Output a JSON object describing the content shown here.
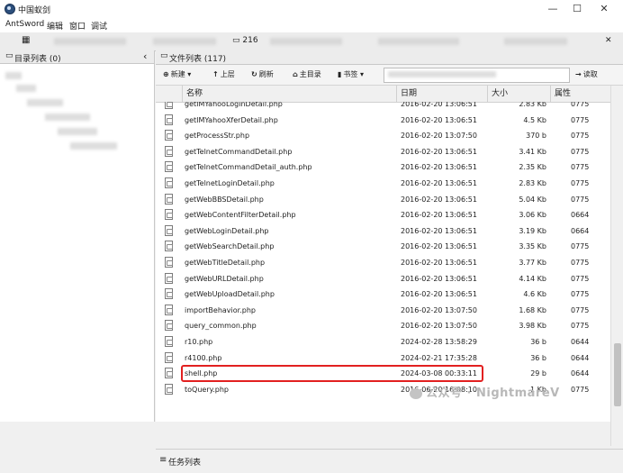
{
  "app": {
    "title": "中国蚁剑",
    "icon": "ant-logo-icon"
  },
  "window_controls": {
    "minimize": "—",
    "maximize": "☐",
    "close": "✕"
  },
  "menu": [
    "AntSword",
    "编辑",
    "窗口",
    "调试"
  ],
  "tabs": {
    "grid_icon": "▦",
    "file_tab_label": "216",
    "close_icon": "✕"
  },
  "left_panel": {
    "title": "目录列表 (0)",
    "collapse_icon": "‹"
  },
  "right_panel": {
    "title": "文件列表 (117)"
  },
  "toolbar": {
    "new_label": "新建",
    "up_label": "上层",
    "refresh_label": "刷新",
    "home_label": "主目录",
    "bookmark_label": "书签",
    "read_label": "读取",
    "path_value": ""
  },
  "columns": {
    "name": "名称",
    "date": "日期",
    "size": "大小",
    "perm": "属性"
  },
  "files": [
    {
      "name": "getIMYahooLoginDetail.php",
      "date": "2016-02-20 13:06:51",
      "size": "2.83 Kb",
      "perm": "0775"
    },
    {
      "name": "getIMYahooXferDetail.php",
      "date": "2016-02-20 13:06:51",
      "size": "4.5 Kb",
      "perm": "0775"
    },
    {
      "name": "getProcessStr.php",
      "date": "2016-02-20 13:07:50",
      "size": "370 b",
      "perm": "0775"
    },
    {
      "name": "getTelnetCommandDetail.php",
      "date": "2016-02-20 13:06:51",
      "size": "3.41 Kb",
      "perm": "0775"
    },
    {
      "name": "getTelnetCommandDetail_auth.php",
      "date": "2016-02-20 13:06:51",
      "size": "2.35 Kb",
      "perm": "0775"
    },
    {
      "name": "getTelnetLoginDetail.php",
      "date": "2016-02-20 13:06:51",
      "size": "2.83 Kb",
      "perm": "0775"
    },
    {
      "name": "getWebBBSDetail.php",
      "date": "2016-02-20 13:06:51",
      "size": "5.04 Kb",
      "perm": "0775"
    },
    {
      "name": "getWebContentFilterDetail.php",
      "date": "2016-02-20 13:06:51",
      "size": "3.06 Kb",
      "perm": "0664"
    },
    {
      "name": "getWebLoginDetail.php",
      "date": "2016-02-20 13:06:51",
      "size": "3.19 Kb",
      "perm": "0664"
    },
    {
      "name": "getWebSearchDetail.php",
      "date": "2016-02-20 13:06:51",
      "size": "3.35 Kb",
      "perm": "0775"
    },
    {
      "name": "getWebTitleDetail.php",
      "date": "2016-02-20 13:06:51",
      "size": "3.77 Kb",
      "perm": "0775"
    },
    {
      "name": "getWebURLDetail.php",
      "date": "2016-02-20 13:06:51",
      "size": "4.14 Kb",
      "perm": "0775"
    },
    {
      "name": "getWebUploadDetail.php",
      "date": "2016-02-20 13:06:51",
      "size": "4.6 Kb",
      "perm": "0775"
    },
    {
      "name": "importBehavior.php",
      "date": "2016-02-20 13:07:50",
      "size": "1.68 Kb",
      "perm": "0775"
    },
    {
      "name": "query_common.php",
      "date": "2016-02-20 13:07:50",
      "size": "3.98 Kb",
      "perm": "0775"
    },
    {
      "name": "r10.php",
      "date": "2024-02-28 13:58:29",
      "size": "36 b",
      "perm": "0644"
    },
    {
      "name": "r4100.php",
      "date": "2024-02-21 17:35:28",
      "size": "36 b",
      "perm": "0644"
    },
    {
      "name": "shell.php",
      "date": "2024-03-08 00:33:11",
      "size": "29 b",
      "perm": "0644"
    },
    {
      "name": "toQuery.php",
      "date": "2016-06-20 16:08:10",
      "size": "1 Kb",
      "perm": "0775"
    }
  ],
  "status_bar": {
    "label": "任务列表",
    "toggle_icon": "≡"
  },
  "watermark": {
    "text": "公众号 · NightmareV"
  }
}
